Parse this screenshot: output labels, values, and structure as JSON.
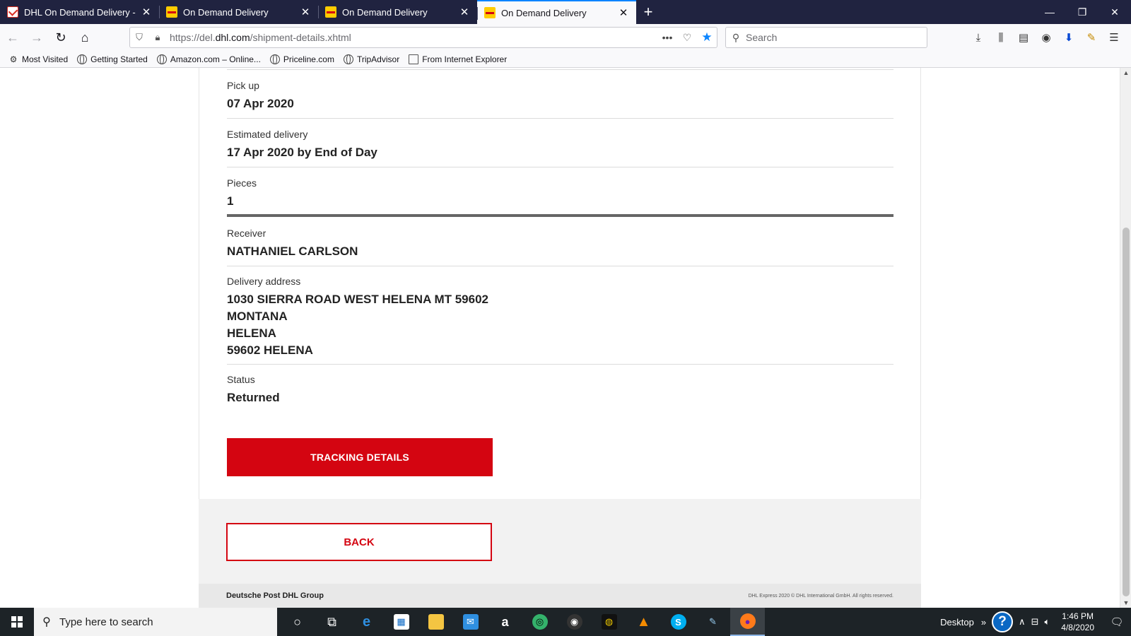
{
  "browser": {
    "tabs": [
      {
        "label": "DHL On Demand Delivery - nos",
        "favicon": "gmail-icon",
        "active": false
      },
      {
        "label": "On Demand Delivery",
        "favicon": "dhl-icon",
        "active": false
      },
      {
        "label": "On Demand Delivery",
        "favicon": "dhl-icon",
        "active": false
      },
      {
        "label": "On Demand Delivery",
        "favicon": "dhl-icon",
        "active": true
      }
    ],
    "url_prefix": "https://del.",
    "url_domain": "dhl.com",
    "url_path": "/shipment-details.xhtml",
    "search_placeholder": "Search",
    "bookmarks": [
      {
        "label": "Most Visited",
        "icon": "gear-icon"
      },
      {
        "label": "Getting Started",
        "icon": "globe-icon"
      },
      {
        "label": "Amazon.com – Online...",
        "icon": "globe-icon"
      },
      {
        "label": "Priceline.com",
        "icon": "globe-icon"
      },
      {
        "label": "TripAdvisor",
        "icon": "globe-icon"
      },
      {
        "label": "From Internet Explorer",
        "icon": "folder-icon"
      }
    ]
  },
  "shipment": {
    "pickup_label": "Pick up",
    "pickup_value": "07 Apr 2020",
    "estimated_label": "Estimated delivery",
    "estimated_value": "17 Apr 2020 by End of Day",
    "pieces_label": "Pieces",
    "pieces_value": "1",
    "receiver_label": "Receiver",
    "receiver_value": "NATHANIEL CARLSON",
    "address_label": "Delivery address",
    "address_lines": [
      "1030 SIERRA ROAD WEST HELENA MT 59602",
      "MONTANA",
      "HELENA",
      "59602 HELENA"
    ],
    "status_label": "Status",
    "status_value": "Returned",
    "tracking_button": "TRACKING DETAILS",
    "back_button": "BACK"
  },
  "footer": {
    "brand": "Deutsche Post DHL Group",
    "copyright": "DHL Express 2020 © DHL International GmbH. All rights reserved."
  },
  "taskbar": {
    "search_placeholder": "Type here to search",
    "desktop_label": "Desktop",
    "chevron": "»",
    "time": "1:46 PM",
    "date": "4/8/2020"
  },
  "colors": {
    "dhl_red": "#d40511",
    "dhl_yellow": "#ffcc00",
    "tabstrip_bg": "#202340",
    "accent_blue": "#0a84ff"
  }
}
